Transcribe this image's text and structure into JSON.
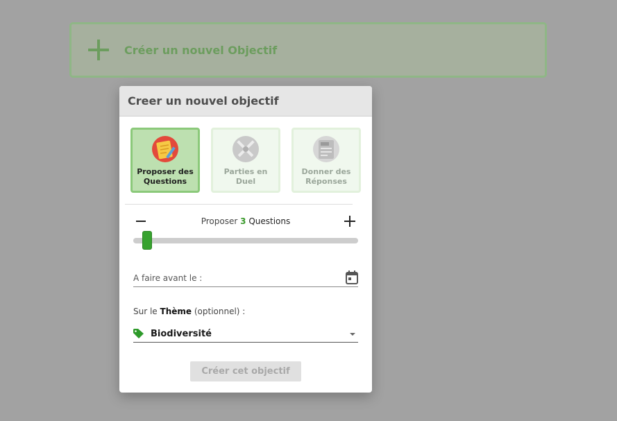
{
  "banner": {
    "label": "Créer un nouvel Objectif"
  },
  "modal": {
    "title": "Creer un nouvel objectif",
    "types": [
      {
        "label": "Proposer des Questions",
        "selected": true,
        "icon": "questions-icon"
      },
      {
        "label": "Parties en Duel",
        "selected": false,
        "icon": "duel-icon"
      },
      {
        "label": "Donner des Réponses",
        "selected": false,
        "icon": "quiz-answers-icon"
      }
    ],
    "count": {
      "prefix": "Proposer",
      "value": "3",
      "unit": "Questions"
    },
    "date": {
      "label": "A faire avant le :"
    },
    "theme": {
      "label_prefix": "Sur le",
      "label_bold": "Thème",
      "label_suffix": "(optionnel) :",
      "value": "Biodiversité"
    },
    "submit_label": "Créer cet objectif"
  },
  "colors": {
    "accent_green": "#37a22f",
    "selected_card": "#bde0b0",
    "backdrop": "#a2a2a2"
  }
}
